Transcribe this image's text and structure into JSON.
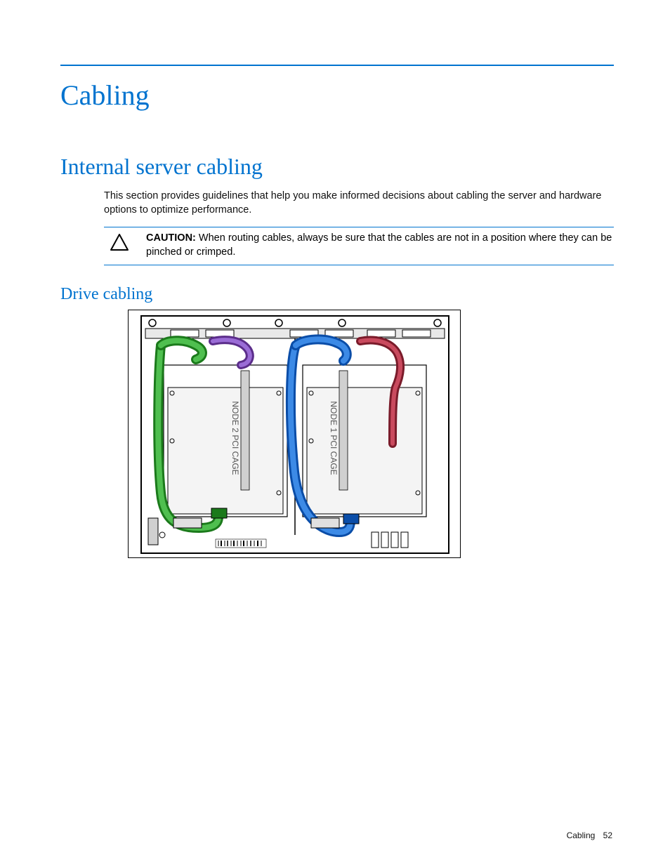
{
  "heading1": "Cabling",
  "heading2": "Internal server cabling",
  "intro_paragraph": "This section provides guidelines that help you make informed decisions about cabling the server and hardware options to optimize performance.",
  "caution": {
    "label": "CAUTION:",
    "text": "When routing cables, always be sure that the cables are not in a position where they can be pinched or crimped."
  },
  "heading3": "Drive cabling",
  "diagram": {
    "labels": {
      "node1": "NODE 1 PCI CAGE",
      "node2": "NODE 2 PCI CAGE"
    }
  },
  "footer": {
    "section": "Cabling",
    "page": "52"
  }
}
